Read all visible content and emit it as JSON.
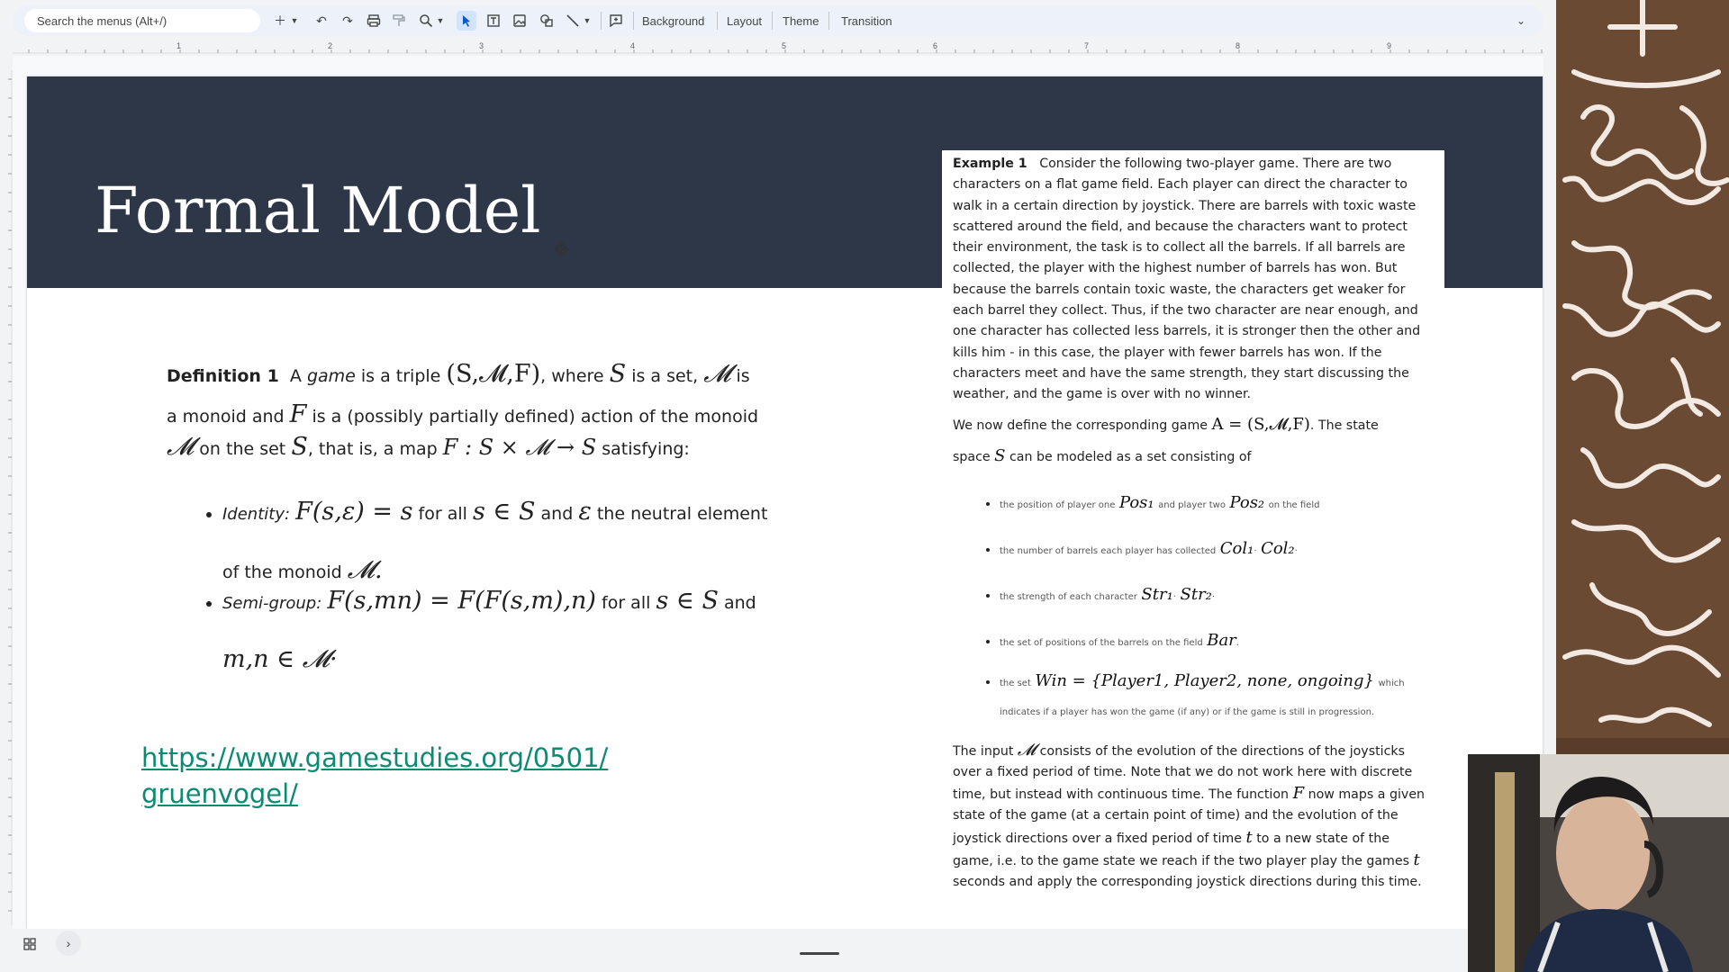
{
  "toolbar": {
    "search_placeholder": "Search the menus (Alt+/)",
    "menus": [
      "Background",
      "Layout",
      "Theme",
      "Transition"
    ],
    "icons": [
      "add-icon",
      "chevron-down-icon",
      "undo-icon",
      "redo-icon",
      "print-icon",
      "paint-format-icon",
      "zoom-icon",
      "select-icon",
      "text-box-icon",
      "image-icon",
      "shape-icon",
      "line-icon",
      "comment-icon"
    ]
  },
  "ruler": {
    "numbers": [
      "1",
      "2",
      "3",
      "4",
      "5",
      "6",
      "7",
      "8",
      "9"
    ]
  },
  "slide": {
    "title": "Formal Model",
    "definition": {
      "head": "Definition 1",
      "t1": "A",
      "game": "game",
      "t2": "is a triple",
      "triple": "(S,𝓜,F)",
      "t3": ", where",
      "S": "S",
      "t4": "is a set,",
      "M": "𝓜",
      "t5": "is",
      "t6": "a monoid and",
      "F": "F",
      "t7": "is a (possibly partially defined) action of the monoid",
      "t8": "on the set",
      "t9": ", that is, a map",
      "map": "F : S × 𝓜 → S",
      "t10": "satisfying:",
      "identity_label": "Identity:",
      "identity_eq": "F(s,ε) = s",
      "for_all": "for all",
      "sinS": "s ∈ S",
      "and": "and",
      "eps": "ε",
      "neutral": "the neutral element",
      "of_monoid": "of the monoid",
      "M_dot": "𝓜.",
      "semigroup_label": "Semi-group:",
      "semigroup_eq": "F(s,mn) = F(F(s,m),n)",
      "mn": "m,n ∈ 𝓜·"
    },
    "link_line1": "https://www.gamestudies.org/0501/",
    "link_line2": "gruenvogel/"
  },
  "example": {
    "head": "Example 1",
    "p1": "Consider the following two-player game. There are two characters on a flat game field. Each player can direct the character to walk in a certain direction by joystick. There are barrels with toxic waste scattered around the field, and because the characters want to protect their environment, the task is to collect all the barrels. If all barrels are collected, the player with the highest number of barrels has won. But because the barrels contain toxic waste, the characters get weaker for each barrel they collect. Thus, if the two character are near enough, and one character has collected less barrels, it is stronger then the other and kills him - in this case, the player with fewer barrels has won. If the characters meet and have the same strength, they start discussing the weather, and the game is over with no winner.",
    "p2a": "We now define the corresponding game",
    "p2math": "A = (S,𝓜,F)",
    "p2b": ". The state",
    "p2c": "space",
    "p2S": "S",
    "p2d": "can be modeled as a set consisting of",
    "items": [
      {
        "pre": "the position of player one",
        "m1": "Pos₁",
        "mid": "and player two",
        "m2": "Pos₂",
        "post": "on the field"
      },
      {
        "pre": "the number of barrels each player has collected",
        "m1": "Col₁",
        "mid": "·",
        "m2": "Col₂",
        "post": "·"
      },
      {
        "pre": "the strength of each character",
        "m1": "Str₁",
        "mid": "·",
        "m2": "Str₂",
        "post": "·"
      },
      {
        "pre": "the set of positions of the barrels on the field",
        "m1": "Bar",
        "mid": ".",
        "m2": "",
        "post": ""
      },
      {
        "pre": "the set",
        "m1": "Win = {Player1, Player2, none, ongoing}",
        "mid": "which",
        "m2": "",
        "post": "indicates if a player has won the game (if any) or if the game is still in progression."
      }
    ],
    "p3a": "The input",
    "p3M": "𝓜",
    "p3b": "consists of the evolution of the directions of the joysticks over a fixed period of time. Note that we do not work here with discrete time, but instead with continuous time. The function",
    "p3F": "F",
    "p3c": "now maps a given state of the game (at a certain point of time) and the evolution of the joystick directions over a fixed period of time",
    "p3t": "t",
    "p3d": "to a new state of the game, i.e. to the game state we reach if the two player play the games",
    "p3t2": "t",
    "p3e": "seconds and apply the corresponding joystick directions during this time."
  }
}
